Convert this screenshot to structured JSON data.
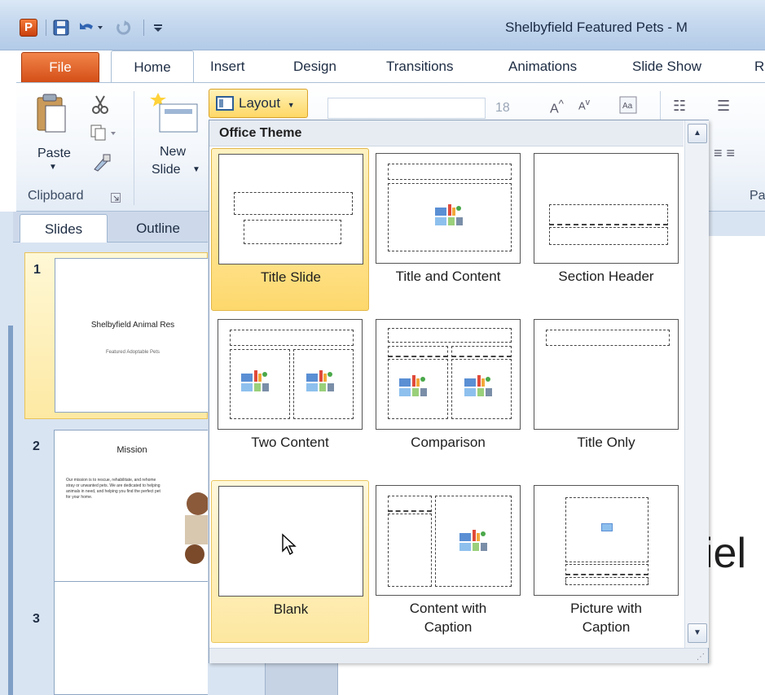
{
  "window": {
    "app_badge": "P",
    "title": "Shelbyfield Featured Pets - M"
  },
  "ribbon_tabs": [
    "File",
    "Home",
    "Insert",
    "Design",
    "Transitions",
    "Animations",
    "Slide Show",
    "R"
  ],
  "ribbon": {
    "paste_label": "Paste",
    "new_slide_label_1": "New",
    "new_slide_label_2": "Slide",
    "layout_label": "Layout",
    "font_size_value": "18",
    "clipboard_group": "Clipboard",
    "paragraph_group": "Par"
  },
  "pane": {
    "tabs": [
      "Slides",
      "Outline"
    ],
    "slides": [
      {
        "number": "1",
        "title": "Shelbyfield Animal Res",
        "subtitle": "Featured Adoptable Pets"
      },
      {
        "number": "2",
        "title": "Mission",
        "bullets": "Our mission is to rescue, rehabilitate, and rehome stray or unwanted pets. We are dedicated to helping animals in need, and helping you find the perfect pet for your home."
      },
      {
        "number": "3",
        "title": ""
      }
    ]
  },
  "canvas": {
    "title_fragment": "iel"
  },
  "layout_gallery": {
    "header": "Office Theme",
    "items": [
      {
        "label": "Title Slide",
        "state": "selected"
      },
      {
        "label": "Title and Content",
        "state": "normal"
      },
      {
        "label": "Section Header",
        "state": "normal"
      },
      {
        "label": "Two Content",
        "state": "normal"
      },
      {
        "label": "Comparison",
        "state": "normal"
      },
      {
        "label": "Title Only",
        "state": "normal"
      },
      {
        "label": "Blank",
        "state": "hover"
      },
      {
        "label": "Content with\nCaption",
        "state": "normal"
      },
      {
        "label": "Picture with\nCaption",
        "state": "normal"
      }
    ]
  },
  "colors": {
    "file_tab": "#d34d16",
    "highlight": "#fdd86c",
    "ribbon_blue": "#c5d8ee"
  }
}
